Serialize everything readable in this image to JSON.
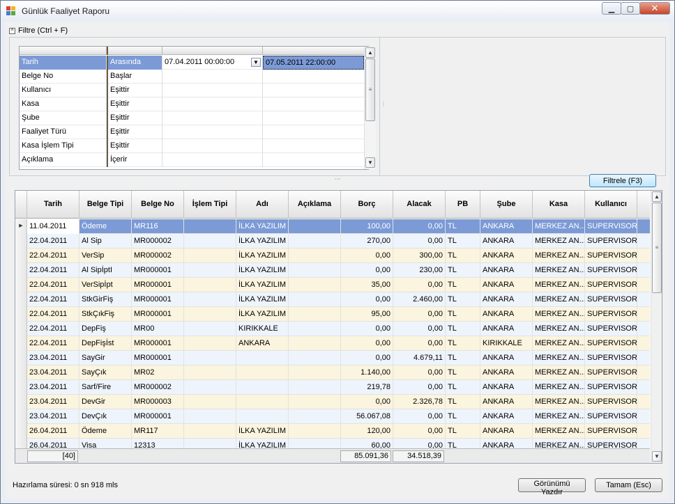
{
  "window": {
    "title": "Günlük Faaliyet Raporu",
    "min_icon": "minimize-icon",
    "max_icon": "maximize-icon",
    "close_icon": "close-icon"
  },
  "filter": {
    "header": "Filtre (Ctrl + F)",
    "rows": [
      {
        "field": "Tarih",
        "op": "Arasında",
        "v1": "07.04.2011 00:00:00",
        "v2": "07.05.2011 22:00:00"
      },
      {
        "field": "Belge No",
        "op": "Başlar",
        "v1": "",
        "v2": ""
      },
      {
        "field": "Kullanıcı",
        "op": "Eşittir",
        "v1": "",
        "v2": ""
      },
      {
        "field": "Kasa",
        "op": "Eşittir",
        "v1": "",
        "v2": ""
      },
      {
        "field": "Şube",
        "op": "Eşittir",
        "v1": "",
        "v2": ""
      },
      {
        "field": "Faaliyet Türü",
        "op": "Eşittir",
        "v1": "",
        "v2": ""
      },
      {
        "field": "Kasa İşlem Tipi",
        "op": "Eşittir",
        "v1": "",
        "v2": ""
      },
      {
        "field": "Açıklama",
        "op": "İçerir",
        "v1": "",
        "v2": ""
      }
    ],
    "apply_button": "Filtrele (F3)"
  },
  "grid": {
    "columns": [
      "Tarih",
      "Belge Tipi",
      "Belge No",
      "İşlem Tipi",
      "Adı",
      "Açıklama",
      "Borç",
      "Alacak",
      "PB",
      "Şube",
      "Kasa",
      "Kullanıcı"
    ],
    "rows": [
      [
        "11.04.2011",
        "Ödeme",
        "MR116",
        "",
        "İLKA YAZILIM",
        "",
        "100,00",
        "0,00",
        "TL",
        "ANKARA",
        "MERKEZ AN...",
        "SUPERVISOR"
      ],
      [
        "22.04.2011",
        "Al Sip",
        "MR000002",
        "",
        "İLKA YAZILIM",
        "",
        "270,00",
        "0,00",
        "TL",
        "ANKARA",
        "MERKEZ AN...",
        "SUPERVISOR"
      ],
      [
        "22.04.2011",
        "VerSip",
        "MR000002",
        "",
        "İLKA YAZILIM",
        "",
        "0,00",
        "300,00",
        "TL",
        "ANKARA",
        "MERKEZ AN...",
        "SUPERVISOR"
      ],
      [
        "22.04.2011",
        "Al SipİptI",
        "MR000001",
        "",
        "İLKA YAZILIM",
        "",
        "0,00",
        "230,00",
        "TL",
        "ANKARA",
        "MERKEZ AN...",
        "SUPERVISOR"
      ],
      [
        "22.04.2011",
        "VerSipİpt",
        "MR000001",
        "",
        "İLKA YAZILIM",
        "",
        "35,00",
        "0,00",
        "TL",
        "ANKARA",
        "MERKEZ AN...",
        "SUPERVISOR"
      ],
      [
        "22.04.2011",
        "StkGirFiş",
        "MR000001",
        "",
        "İLKA YAZILIM",
        "",
        "0,00",
        "2.460,00",
        "TL",
        "ANKARA",
        "MERKEZ AN...",
        "SUPERVISOR"
      ],
      [
        "22.04.2011",
        "StkÇıkFiş",
        "MR000001",
        "",
        "İLKA YAZILIM",
        "",
        "95,00",
        "0,00",
        "TL",
        "ANKARA",
        "MERKEZ AN...",
        "SUPERVISOR"
      ],
      [
        "22.04.2011",
        "DepFiş",
        "MR00",
        "",
        "KIRIKKALE",
        "",
        "0,00",
        "0,00",
        "TL",
        "ANKARA",
        "MERKEZ AN...",
        "SUPERVISOR"
      ],
      [
        "22.04.2011",
        "DepFişİst",
        "MR000001",
        "",
        "ANKARA",
        "",
        "0,00",
        "0,00",
        "TL",
        "KIRIKKALE",
        "MERKEZ AN...",
        "SUPERVISOR"
      ],
      [
        "23.04.2011",
        "SayGir",
        "MR000001",
        "",
        "",
        "",
        "0,00",
        "4.679,11",
        "TL",
        "ANKARA",
        "MERKEZ AN...",
        "SUPERVISOR"
      ],
      [
        "23.04.2011",
        "SayÇık",
        "MR02",
        "",
        "",
        "",
        "1.140,00",
        "0,00",
        "TL",
        "ANKARA",
        "MERKEZ AN...",
        "SUPERVISOR"
      ],
      [
        "23.04.2011",
        "Sarf/Fire",
        "MR000002",
        "",
        "",
        "",
        "219,78",
        "0,00",
        "TL",
        "ANKARA",
        "MERKEZ AN...",
        "SUPERVISOR"
      ],
      [
        "23.04.2011",
        "DevGir",
        "MR000003",
        "",
        "",
        "",
        "0,00",
        "2.326,78",
        "TL",
        "ANKARA",
        "MERKEZ AN...",
        "SUPERVISOR"
      ],
      [
        "23.04.2011",
        "DevÇık",
        "MR000001",
        "",
        "",
        "",
        "56.067,08",
        "0,00",
        "TL",
        "ANKARA",
        "MERKEZ AN...",
        "SUPERVISOR"
      ],
      [
        "26.04.2011",
        "Ödeme",
        "MR117",
        "",
        "İLKA YAZILIM",
        "",
        "120,00",
        "0,00",
        "TL",
        "ANKARA",
        "MERKEZ AN...",
        "SUPERVISOR"
      ],
      [
        "26.04.2011",
        "Visa",
        "12313",
        "",
        "İLKA YAZILIM",
        "",
        "60,00",
        "0,00",
        "TL",
        "ANKARA",
        "MERKEZ AN...",
        "SUPERVISOR"
      ]
    ],
    "footer": {
      "count": "[40]",
      "borc_total": "85.091,36",
      "alacak_total": "34.518,39"
    }
  },
  "status": {
    "prep_time": "Hazırlama süresi: 0 sn 918 mls"
  },
  "buttons": {
    "print": "Görünümü Yazdır",
    "ok": "Tamam (Esc)"
  },
  "colors": {
    "selection": "#7b9ad6",
    "row_odd": "#fbf4de",
    "row_even": "#eef4fb"
  }
}
